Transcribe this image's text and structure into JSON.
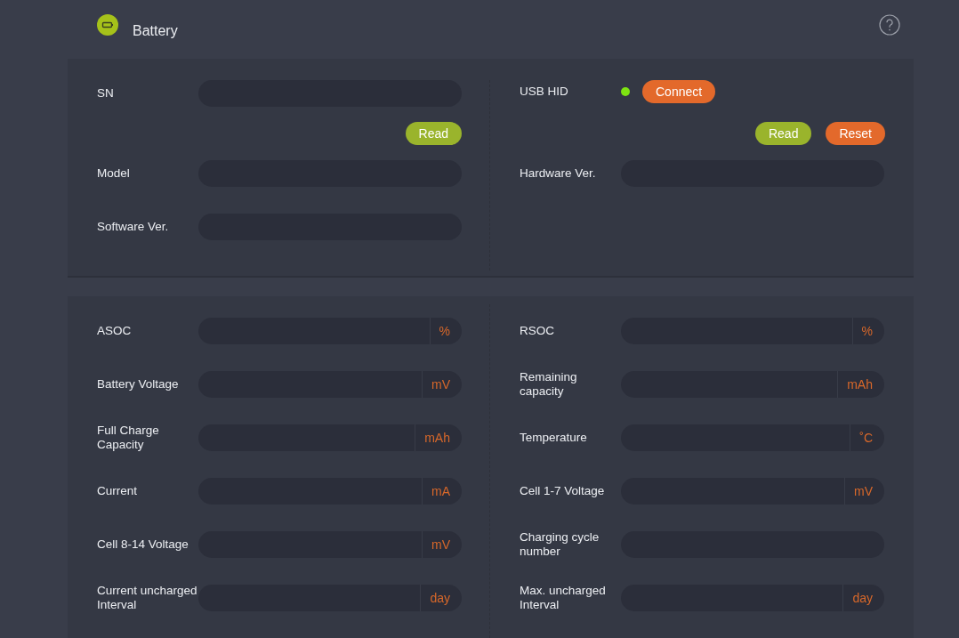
{
  "header": {
    "title": "Battery"
  },
  "device": {
    "left": [
      {
        "kind": "field",
        "label": "SN"
      },
      {
        "kind": "buttons",
        "buttons": [
          {
            "label": "Read",
            "color": "#9ab42c"
          }
        ]
      },
      {
        "kind": "field",
        "label": "Model"
      },
      {
        "kind": "field",
        "label": "Software Ver."
      }
    ],
    "right": [
      {
        "kind": "status",
        "label": "USB HID",
        "connected": true,
        "button": {
          "label": "Connect",
          "color": "#e3692b"
        }
      },
      {
        "kind": "buttons",
        "buttons": [
          {
            "label": "Read",
            "color": "#9ab42c"
          },
          {
            "label": "Reset",
            "color": "#e3692b"
          }
        ]
      },
      {
        "kind": "field",
        "label": "Hardware Ver."
      }
    ]
  },
  "measurements": {
    "left": [
      {
        "label": "ASOC",
        "unit": "%"
      },
      {
        "label": "Battery Voltage",
        "unit": "mV"
      },
      {
        "label": "Full Charge Capacity",
        "unit": "mAh"
      },
      {
        "label": "Current",
        "unit": "mA"
      },
      {
        "label": "Cell 8-14 Voltage",
        "unit": "mV"
      },
      {
        "label": "Current uncharged Interval",
        "unit": "day"
      }
    ],
    "right": [
      {
        "label": "RSOC",
        "unit": "%"
      },
      {
        "label": "Remaining capacity",
        "unit": "mAh"
      },
      {
        "label": "Temperature",
        "unit": "˚C"
      },
      {
        "label": "Cell 1-7 Voltage",
        "unit": "mV"
      },
      {
        "label": "Charging cycle number"
      },
      {
        "label": "Max. uncharged Interval",
        "unit": "day"
      }
    ]
  }
}
